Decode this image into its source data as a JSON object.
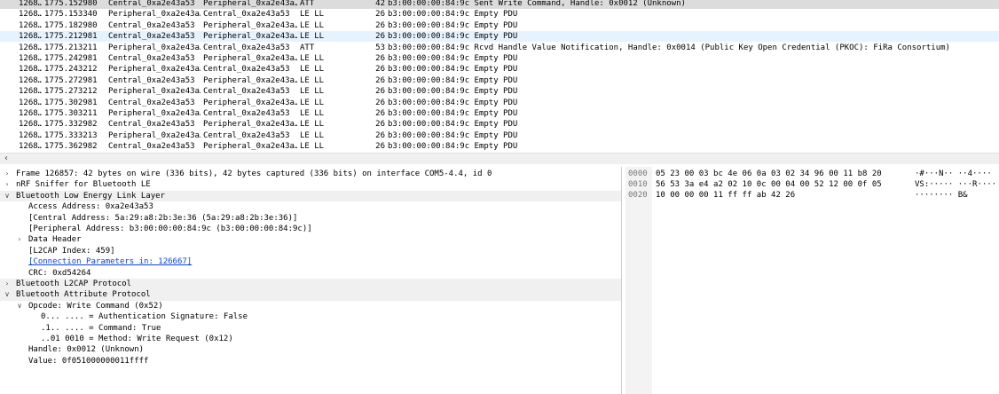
{
  "packets": [
    {
      "no": "1268…",
      "time": "1775.152980",
      "src": "Central_0xa2e43a53",
      "dst": "Peripheral_0xa2e43a…",
      "proto": "ATT",
      "len": "42",
      "info": "b3:00:00:00:84:9c Sent Write Command, Handle: 0x0012 (Unknown)"
    },
    {
      "no": "1268…",
      "time": "1775.153340",
      "src": "Peripheral_0xa2e43a…",
      "dst": "Central_0xa2e43a53",
      "proto": "LE LL",
      "len": "26",
      "info": "b3:00:00:00:84:9c Empty PDU"
    },
    {
      "no": "1268…",
      "time": "1775.182980",
      "src": "Central_0xa2e43a53",
      "dst": "Peripheral_0xa2e43a…",
      "proto": "LE LL",
      "len": "26",
      "info": "b3:00:00:00:84:9c Empty PDU"
    },
    {
      "no": "1268…",
      "time": "1775.212981",
      "src": "Central_0xa2e43a53",
      "dst": "Peripheral_0xa2e43a…",
      "proto": "LE LL",
      "len": "26",
      "info": "b3:00:00:00:84:9c Empty PDU"
    },
    {
      "no": "1268…",
      "time": "1775.213211",
      "src": "Peripheral_0xa2e43a…",
      "dst": "Central_0xa2e43a53",
      "proto": "ATT",
      "len": "53",
      "info": "b3:00:00:00:84:9c Rcvd Handle Value Notification, Handle: 0x0014 (Public Key Open Credential (PKOC): FiRa Consortium)"
    },
    {
      "no": "1268…",
      "time": "1775.242981",
      "src": "Central_0xa2e43a53",
      "dst": "Peripheral_0xa2e43a…",
      "proto": "LE LL",
      "len": "26",
      "info": "b3:00:00:00:84:9c Empty PDU"
    },
    {
      "no": "1268…",
      "time": "1775.243212",
      "src": "Peripheral_0xa2e43a…",
      "dst": "Central_0xa2e43a53",
      "proto": "LE LL",
      "len": "26",
      "info": "b3:00:00:00:84:9c Empty PDU"
    },
    {
      "no": "1268…",
      "time": "1775.272981",
      "src": "Central_0xa2e43a53",
      "dst": "Peripheral_0xa2e43a…",
      "proto": "LE LL",
      "len": "26",
      "info": "b3:00:00:00:84:9c Empty PDU"
    },
    {
      "no": "1268…",
      "time": "1775.273212",
      "src": "Peripheral_0xa2e43a…",
      "dst": "Central_0xa2e43a53",
      "proto": "LE LL",
      "len": "26",
      "info": "b3:00:00:00:84:9c Empty PDU"
    },
    {
      "no": "1268…",
      "time": "1775.302981",
      "src": "Central_0xa2e43a53",
      "dst": "Peripheral_0xa2e43a…",
      "proto": "LE LL",
      "len": "26",
      "info": "b3:00:00:00:84:9c Empty PDU"
    },
    {
      "no": "1268…",
      "time": "1775.303211",
      "src": "Peripheral_0xa2e43a…",
      "dst": "Central_0xa2e43a53",
      "proto": "LE LL",
      "len": "26",
      "info": "b3:00:00:00:84:9c Empty PDU"
    },
    {
      "no": "1268…",
      "time": "1775.332982",
      "src": "Central_0xa2e43a53",
      "dst": "Peripheral_0xa2e43a…",
      "proto": "LE LL",
      "len": "26",
      "info": "b3:00:00:00:84:9c Empty PDU"
    },
    {
      "no": "1268…",
      "time": "1775.333213",
      "src": "Peripheral_0xa2e43a…",
      "dst": "Central_0xa2e43a53",
      "proto": "LE LL",
      "len": "26",
      "info": "b3:00:00:00:84:9c Empty PDU"
    },
    {
      "no": "1268…",
      "time": "1775.362982",
      "src": "Central_0xa2e43a53",
      "dst": "Peripheral_0xa2e43a…",
      "proto": "LE LL",
      "len": "26",
      "info": "b3:00:00:00:84:9c Empty PDU"
    }
  ],
  "details": [
    {
      "text": "Frame 126857: 42 bytes on wire (336 bits), 42 bytes captured (336 bits) on interface COM5-4.4, id 0",
      "depth": 0,
      "arrow": "collapsed"
    },
    {
      "text": "nRF Sniffer for Bluetooth LE",
      "depth": 0,
      "arrow": "collapsed"
    },
    {
      "text": "Bluetooth Low Energy Link Layer",
      "depth": 0,
      "arrow": "expanded"
    },
    {
      "text": "Access Address: 0xa2e43a53",
      "depth": 1,
      "arrow": ""
    },
    {
      "text": "[Central Address: 5a:29:a8:2b:3e:36 (5a:29:a8:2b:3e:36)]",
      "depth": 1,
      "arrow": ""
    },
    {
      "text": "[Peripheral Address: b3:00:00:00:84:9c (b3:00:00:00:84:9c)]",
      "depth": 1,
      "arrow": ""
    },
    {
      "text": "Data Header",
      "depth": 1,
      "arrow": "collapsed"
    },
    {
      "text": "[L2CAP Index: 459]",
      "depth": 1,
      "arrow": ""
    },
    {
      "text": "[Connection Parameters in: 126667]",
      "depth": 1,
      "arrow": "",
      "link": true
    },
    {
      "text": "CRC: 0xd54264",
      "depth": 1,
      "arrow": ""
    },
    {
      "text": "Bluetooth L2CAP Protocol",
      "depth": 0,
      "arrow": "collapsed"
    },
    {
      "text": "Bluetooth Attribute Protocol",
      "depth": 0,
      "arrow": "expanded"
    },
    {
      "text": "Opcode: Write Command (0x52)",
      "depth": 1,
      "arrow": "expanded"
    },
    {
      "text": "0... .... = Authentication Signature: False",
      "depth": 2,
      "arrow": ""
    },
    {
      "text": ".1.. .... = Command: True",
      "depth": 2,
      "arrow": ""
    },
    {
      "text": "..01 0010 = Method: Write Request (0x12)",
      "depth": 2,
      "arrow": ""
    },
    {
      "text": "Handle: 0x0012 (Unknown)",
      "depth": 1,
      "arrow": ""
    },
    {
      "text": "Value: 0f051000000011ffff",
      "depth": 1,
      "arrow": ""
    }
  ],
  "hex": [
    {
      "offset": "0000",
      "bytes": "05 23 00 03 bc 4e 06 0a  03 02 34 96 00 11 b8 20",
      "ascii": "·#···N·· ··4···· "
    },
    {
      "offset": "0010",
      "bytes": "56 53 3a e4 a2 02 10 0c  00 04 00 52 12 00 0f 05",
      "ascii": "VS:····· ···R····"
    },
    {
      "offset": "0020",
      "bytes": "10 00 00 00 11 ff ff ab  42 26",
      "ascii": "········ B&"
    }
  ],
  "icons": {
    "expanded": "expanded-arrow-icon",
    "collapsed": "collapsed-arrow-icon",
    "scroll_left": "scroll-left-arrow-icon"
  },
  "colors": {
    "selected_row": "#dcdcdc",
    "hover_row": "#e5f3ff",
    "link": "#0b45d6"
  }
}
